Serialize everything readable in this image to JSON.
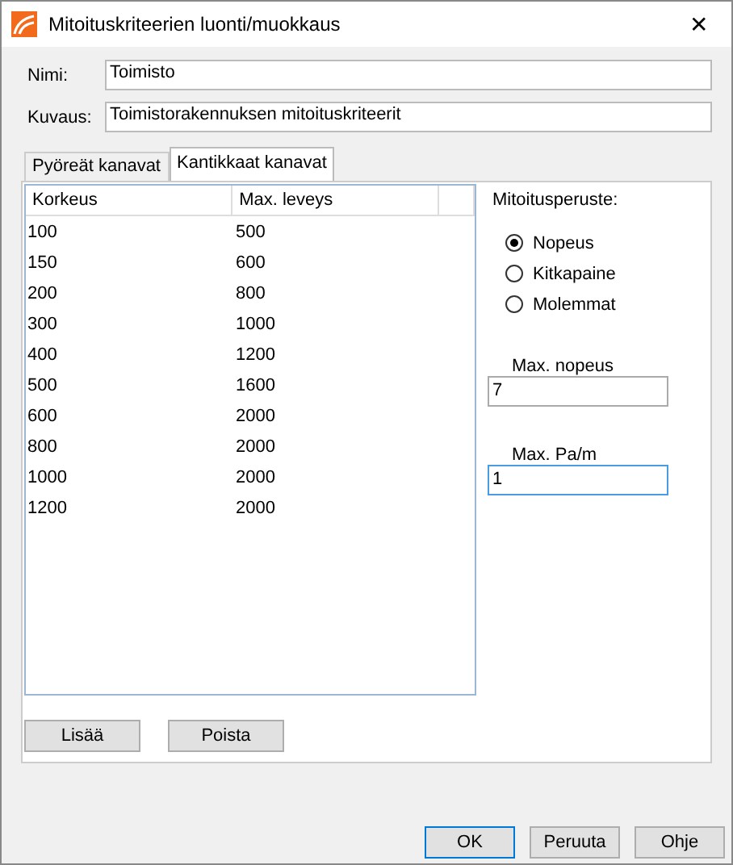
{
  "window": {
    "title": "Mitoituskriteerien luonti/muokkaus",
    "close": "✕"
  },
  "fields": [
    {
      "label": "Nimi:",
      "value": "Toimisto"
    },
    {
      "label": "Kuvaus:",
      "value": "Toimistorakennuksen mitoituskriteerit"
    }
  ],
  "tabs": [
    {
      "label": "Pyöreät kanavat",
      "selected": false
    },
    {
      "label": "Kantikkaat kanavat",
      "selected": true
    }
  ],
  "table": {
    "columns": [
      "Korkeus",
      "Max. leveys"
    ],
    "rows": [
      [
        "100",
        "500"
      ],
      [
        "150",
        "600"
      ],
      [
        "200",
        "800"
      ],
      [
        "300",
        "1000"
      ],
      [
        "400",
        "1200"
      ],
      [
        "500",
        "1600"
      ],
      [
        "600",
        "2000"
      ],
      [
        "800",
        "2000"
      ],
      [
        "1000",
        "2000"
      ],
      [
        "1200",
        "2000"
      ]
    ]
  },
  "criteria": {
    "title": "Mitoitusperuste:",
    "options": [
      {
        "label": "Nopeus",
        "selected": true
      },
      {
        "label": "Kitkapaine",
        "selected": false
      },
      {
        "label": "Molemmat",
        "selected": false
      }
    ],
    "inputs": [
      {
        "label": "Max. nopeus",
        "value": "7",
        "focused": false
      },
      {
        "label": "Max. Pa/m",
        "value": "1",
        "focused": true
      }
    ]
  },
  "table_buttons": [
    "Lisää",
    "Poista"
  ],
  "buttons": [
    {
      "label": "OK",
      "default": true
    },
    {
      "label": "Peruuta",
      "default": false
    },
    {
      "label": "Ohje",
      "default": false
    }
  ]
}
